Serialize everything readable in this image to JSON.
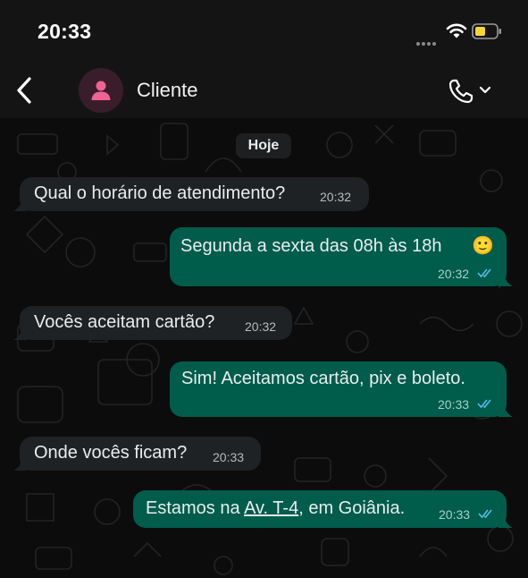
{
  "status_bar": {
    "time": "20:33"
  },
  "header": {
    "contact_name": "Cliente"
  },
  "chat": {
    "day_label": "Hoje",
    "messages": [
      {
        "direction": "in",
        "text": "Qual o horário de atendimento?",
        "time": "20:32"
      },
      {
        "direction": "out",
        "text": "Segunda a sexta das 08h às 18h",
        "emoji": "🙂",
        "time": "20:32",
        "status": "read"
      },
      {
        "direction": "in",
        "text": "Vocês aceitam cartão?",
        "time": "20:32"
      },
      {
        "direction": "out",
        "text": "Sim! Aceitamos cartão, pix e boleto.",
        "time": "20:33",
        "status": "read"
      },
      {
        "direction": "in",
        "text": "Onde vocês ficam?",
        "time": "20:33"
      },
      {
        "direction": "out",
        "text_before": "Estamos na ",
        "link_text": "Av. T-4",
        "text_after": ", em Goiânia.",
        "time": "20:33",
        "status": "read"
      }
    ]
  },
  "icons": {
    "back": "chevron-left-icon",
    "avatar": "person-icon",
    "call": "phone-icon",
    "read_receipt": "double-check-icon",
    "wifi": "wifi-icon",
    "battery": "battery-icon",
    "signal": "signal-icon"
  },
  "colors": {
    "incoming_bubble": "#1f2225",
    "outgoing_bubble": "#005c4b",
    "read_ticks": "#53bdeb",
    "avatar_icon": "#f06292",
    "battery_level": "#f7d531"
  }
}
